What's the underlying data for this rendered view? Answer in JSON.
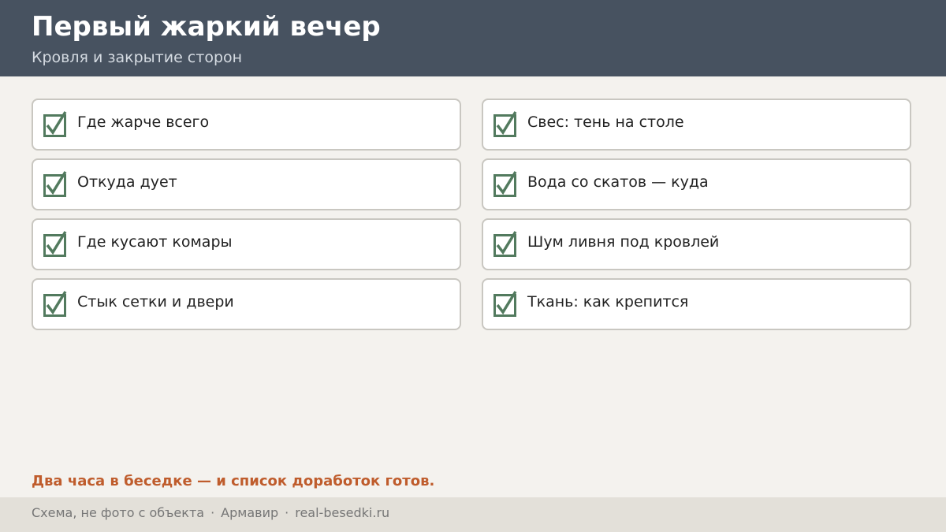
{
  "header": {
    "title": "Первый жаркий вечер",
    "subtitle": "Кровля и закрытие сторон"
  },
  "checklist": [
    {
      "label": "Где жарче всего",
      "checked": true
    },
    {
      "label": "Свес: тень на столе",
      "checked": true
    },
    {
      "label": "Откуда дует",
      "checked": true
    },
    {
      "label": "Вода со скатов — куда",
      "checked": true
    },
    {
      "label": "Где кусают комары",
      "checked": true
    },
    {
      "label": "Шум ливня под кровлей",
      "checked": true
    },
    {
      "label": "Стык сетки и двери",
      "checked": true
    },
    {
      "label": "Ткань: как крепится",
      "checked": true
    }
  ],
  "tagline": "Два часа в беседке — и список доработок готов.",
  "footer": {
    "note": "Схема, не фото с объекта",
    "separator": "·",
    "city": "Армавир",
    "site": "real-besedki.ru"
  },
  "colors": {
    "header_bg": "#475260",
    "accent": "#bf5c2c",
    "check": "#527a5e",
    "page_bg": "#f4f2ee",
    "footer_bg": "#e3e0d9"
  },
  "icons": {
    "checkbox": "checkbox-checked-icon"
  }
}
